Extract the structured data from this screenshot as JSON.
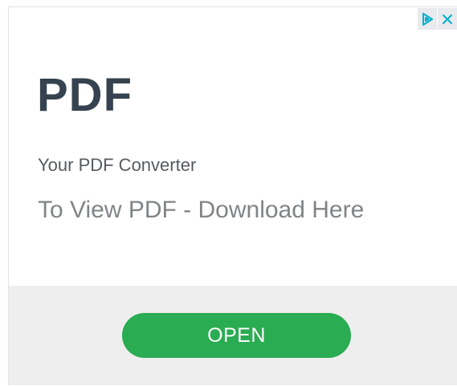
{
  "ad": {
    "headline": "PDF",
    "advertiser": "Your PDF Converter",
    "body": "To View PDF - Download Here",
    "cta_label": "OPEN"
  },
  "adchoices": {
    "icons": [
      "adchoices-triangle-icon",
      "close-x-icon"
    ],
    "icon_color": "#00aecd"
  },
  "colors": {
    "headline": "#34434f",
    "cta_background": "#2aac52",
    "cta_band": "#eeeeee"
  }
}
